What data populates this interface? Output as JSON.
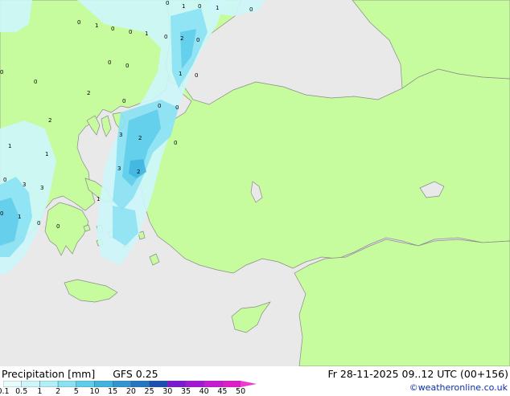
{
  "title": {
    "product": "Precipitation [mm]",
    "model": "GFS 0.25",
    "valid_time": "Fr 28-11-2025 09..12 UTC (00+156)"
  },
  "credit": "©weatheronline.co.uk",
  "legend": {
    "levels": [
      "0.1",
      "0.5",
      "1",
      "2",
      "5",
      "10",
      "15",
      "20",
      "25",
      "30",
      "35",
      "40",
      "45",
      "50"
    ],
    "colors": [
      "#e6fdfd",
      "#cdf6fb",
      "#b0eef8",
      "#8ae1f3",
      "#5fcdea",
      "#3fb4df",
      "#2f96d3",
      "#2376c2",
      "#1b4fb0",
      "#7b18d2",
      "#a218d4",
      "#c61ad3",
      "#e01cc8",
      "#ef3ad2"
    ]
  },
  "colors": {
    "sea": "#e9e9e9",
    "land_in_domain": "#c6fb9e",
    "land_outside": "#e9e9e9",
    "coastline": "#8a8a8a"
  },
  "map_labels": {
    "values": [
      "0",
      "1",
      "0",
      "1",
      "0",
      "0",
      "1",
      "0",
      "0",
      "1",
      "0",
      "2",
      "0",
      "0",
      "0",
      "1",
      "0",
      "0",
      "0",
      "2",
      "0",
      "0",
      "0",
      "2",
      "3",
      "2",
      "0",
      "1",
      "3",
      "2",
      "1",
      "0",
      "3",
      "3",
      "1",
      "0",
      "1",
      "0",
      "0"
    ]
  }
}
